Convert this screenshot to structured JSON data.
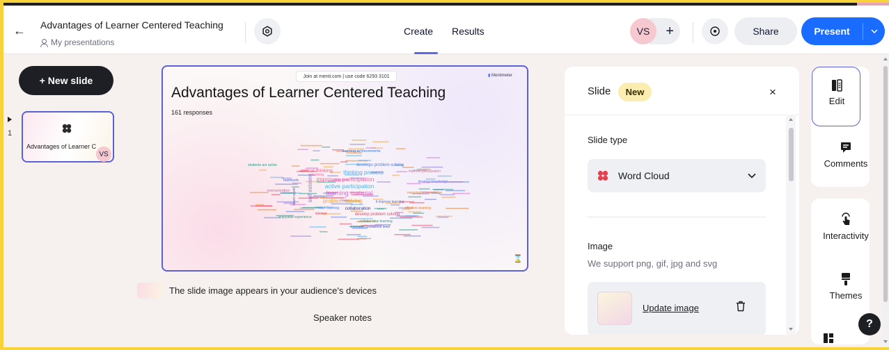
{
  "header": {
    "title": "Advantages of Learner Centered Teaching",
    "breadcrumb": "My presentations",
    "tabs": [
      {
        "label": "Create",
        "active": true
      },
      {
        "label": "Results",
        "active": false
      }
    ],
    "avatar_initials": "VS",
    "add_symbol": "+",
    "share_label": "Share",
    "present_label": "Present",
    "accent_color": "#196cff"
  },
  "sidebar": {
    "new_slide_label": "+ New slide",
    "slides": [
      {
        "number": "1",
        "title": "Advantages of Learner C",
        "avatar": "VS",
        "icon": "word-cloud-icon"
      }
    ]
  },
  "slide": {
    "join_text": "Join at menti.com | use code  6293 3101",
    "brand": "Mentimeter",
    "title": "Advantages of Learner Centered Teaching",
    "responses": "161 responses",
    "words": [
      {
        "text": "learning material",
        "color": "#d56ad1",
        "size": 9
      },
      {
        "text": "active participation",
        "color": "#4fb1e6",
        "size": 8.5
      },
      {
        "text": "improves participation",
        "color": "#e86a9c",
        "size": 8.5
      },
      {
        "text": "thinking process",
        "color": "#58a6e4",
        "size": 8
      },
      {
        "text": "problem solving",
        "color": "#f2a33a",
        "size": 8
      },
      {
        "text": "critical thinking",
        "color": "#ec6b8e",
        "size": 7
      },
      {
        "text": "develops problem-solving",
        "color": "#5b7fe0",
        "size": 6
      },
      {
        "text": "learning achievements",
        "color": "#3c7ad8",
        "size": 5.5
      },
      {
        "text": "collaboration",
        "color": "#2d3a8c",
        "size": 6.5
      },
      {
        "text": "develop problem solving",
        "color": "#e04b6a",
        "size": 6
      },
      {
        "text": "memorization",
        "color": "#d05fa7",
        "size": 5.5
      },
      {
        "text": "self esteem",
        "color": "#8b7bd3",
        "size": 8
      },
      {
        "text": "team work",
        "color": "#4a6ec7",
        "size": 5.5
      },
      {
        "text": "meaningful knowledge",
        "color": "#d28a3a",
        "size": 5
      },
      {
        "text": "it improve learning",
        "color": "#4d6fe0",
        "size": 5
      },
      {
        "text": "effective learning",
        "color": "#e8822b",
        "size": 5
      },
      {
        "text": "collaborative learning",
        "color": "#2f9b8a",
        "size": 5
      },
      {
        "text": "increase confidence level",
        "color": "#3d5fc6",
        "size": 5
      },
      {
        "text": "enjoyable experience",
        "color": "#2f9b8a",
        "size": 5
      },
      {
        "text": "own learning",
        "color": "#5b7fe0",
        "size": 5
      },
      {
        "text": "students are active",
        "color": "#2f9b8a",
        "size": 5
      },
      {
        "text": "develop knowledge",
        "color": "#5b7fe0",
        "size": 5
      },
      {
        "text": "interest",
        "color": "#e0414f",
        "size": 5
      },
      {
        "text": "teamwork",
        "color": "#4a6ec7",
        "size": 5
      },
      {
        "text": "reasoning",
        "color": "#e86a9c",
        "size": 5
      },
      {
        "text": "improve participation",
        "color": "#e86a9c",
        "size": 5
      }
    ]
  },
  "notes": {
    "image_note": "The slide image appears in your audience's devices",
    "speaker_notes": "Speaker notes"
  },
  "panel": {
    "title": "Slide",
    "badge": "New",
    "close_symbol": "×",
    "slide_type_label": "Slide type",
    "slide_type_value": "Word Cloud",
    "image_label": "Image",
    "image_help": "We support png, gif, jpg and svg",
    "update_image_label": "Update image"
  },
  "toolbar": {
    "items": [
      {
        "label": "Edit",
        "icon": "edit-icon",
        "active": true
      },
      {
        "label": "Comments",
        "icon": "comment-icon",
        "active": false
      },
      {
        "label": "Interactivity",
        "icon": "interactivity-icon",
        "active": false
      },
      {
        "label": "Themes",
        "icon": "theme-brush-icon",
        "active": false
      }
    ],
    "help_symbol": "?"
  }
}
